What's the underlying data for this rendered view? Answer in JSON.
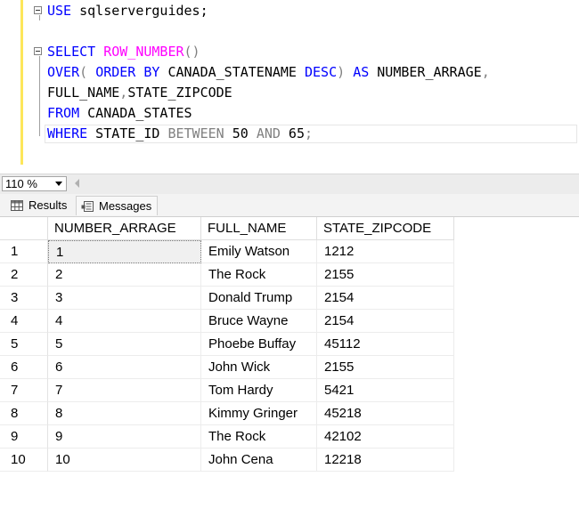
{
  "editor": {
    "lines": [
      {
        "parts": [
          {
            "t": "USE",
            "c": "kw"
          },
          {
            "t": " sqlserverguides;",
            "c": ""
          }
        ]
      },
      {
        "parts": []
      },
      {
        "parts": [
          {
            "t": "SELECT",
            "c": "kw"
          },
          {
            "t": " ",
            "c": ""
          },
          {
            "t": "ROW_NUMBER",
            "c": "fn"
          },
          {
            "t": "()",
            "c": "gray"
          }
        ]
      },
      {
        "parts": [
          {
            "t": "OVER",
            "c": "kw"
          },
          {
            "t": "(",
            "c": "gray"
          },
          {
            "t": " ",
            "c": ""
          },
          {
            "t": "ORDER",
            "c": "kw"
          },
          {
            "t": " ",
            "c": ""
          },
          {
            "t": "BY",
            "c": "kw"
          },
          {
            "t": " CANADA_STATENAME ",
            "c": ""
          },
          {
            "t": "DESC",
            "c": "kw"
          },
          {
            "t": ")",
            "c": "gray"
          },
          {
            "t": " ",
            "c": ""
          },
          {
            "t": "AS",
            "c": "kw"
          },
          {
            "t": " NUMBER_ARRAGE",
            "c": ""
          },
          {
            "t": ",",
            "c": "gray"
          }
        ]
      },
      {
        "parts": [
          {
            "t": "FULL_NAME",
            "c": ""
          },
          {
            "t": ",",
            "c": "gray"
          },
          {
            "t": "STATE_ZIPCODE",
            "c": ""
          }
        ]
      },
      {
        "parts": [
          {
            "t": "FROM",
            "c": "kw"
          },
          {
            "t": " CANADA_STATES",
            "c": ""
          }
        ]
      },
      {
        "parts": [
          {
            "t": "WHERE",
            "c": "kw"
          },
          {
            "t": " STATE_ID ",
            "c": ""
          },
          {
            "t": "BETWEEN",
            "c": "gray"
          },
          {
            "t": " 50 ",
            "c": ""
          },
          {
            "t": "AND",
            "c": "gray"
          },
          {
            "t": " 65",
            "c": ""
          },
          {
            "t": ";",
            "c": "gray"
          }
        ]
      }
    ]
  },
  "zoom": {
    "value": "110 %"
  },
  "tabs": {
    "results": "Results",
    "messages": "Messages"
  },
  "grid": {
    "columns": [
      "NUMBER_ARRAGE",
      "FULL_NAME",
      "STATE_ZIPCODE"
    ],
    "rows": [
      {
        "n": "1",
        "c": [
          "1",
          "Emily Watson",
          "1212"
        ]
      },
      {
        "n": "2",
        "c": [
          "2",
          "The Rock",
          "2155"
        ]
      },
      {
        "n": "3",
        "c": [
          "3",
          "Donald Trump",
          "2154"
        ]
      },
      {
        "n": "4",
        "c": [
          "4",
          "Bruce Wayne",
          "2154"
        ]
      },
      {
        "n": "5",
        "c": [
          "5",
          "Phoebe Buffay",
          "45112"
        ]
      },
      {
        "n": "6",
        "c": [
          "6",
          "John Wick",
          "2155"
        ]
      },
      {
        "n": "7",
        "c": [
          "7",
          "Tom Hardy",
          "5421"
        ]
      },
      {
        "n": "8",
        "c": [
          "8",
          "Kimmy Gringer",
          "45218"
        ]
      },
      {
        "n": "9",
        "c": [
          "9",
          "The Rock",
          "42102"
        ]
      },
      {
        "n": "10",
        "c": [
          "10",
          "John Cena",
          "12218"
        ]
      }
    ]
  },
  "colors": {
    "keyword": "#0000ff",
    "function": "#ff00ff",
    "operator": "#808080",
    "gutter": "#fde65a"
  }
}
